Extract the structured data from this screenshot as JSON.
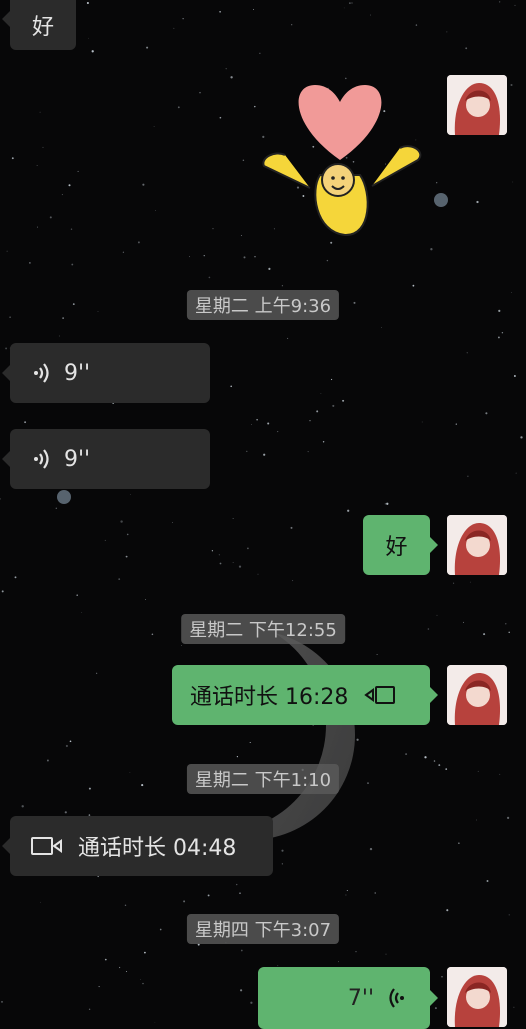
{
  "messages": {
    "top_text": "好",
    "ts1": "星期二 上午9:36",
    "voice1_duration": "9''",
    "voice2_duration": "9''",
    "sent_text": "好",
    "ts2": "星期二 下午12:55",
    "call_sent_text": "通话时长 16:28",
    "ts3": "星期二 下午1:10",
    "call_recv_text": "通话时长 04:48",
    "ts4": "星期四 下午3:07",
    "voice3_duration": "7''"
  },
  "icons": {
    "voice": "voice-wave-icon",
    "video": "video-call-icon",
    "sticker": "heart-person-sticker"
  },
  "colors": {
    "background": "#070708",
    "bubble_received": "#2b2b2b",
    "bubble_sent": "#5fb46f",
    "timestamp_bg": "#5a5a5a"
  }
}
